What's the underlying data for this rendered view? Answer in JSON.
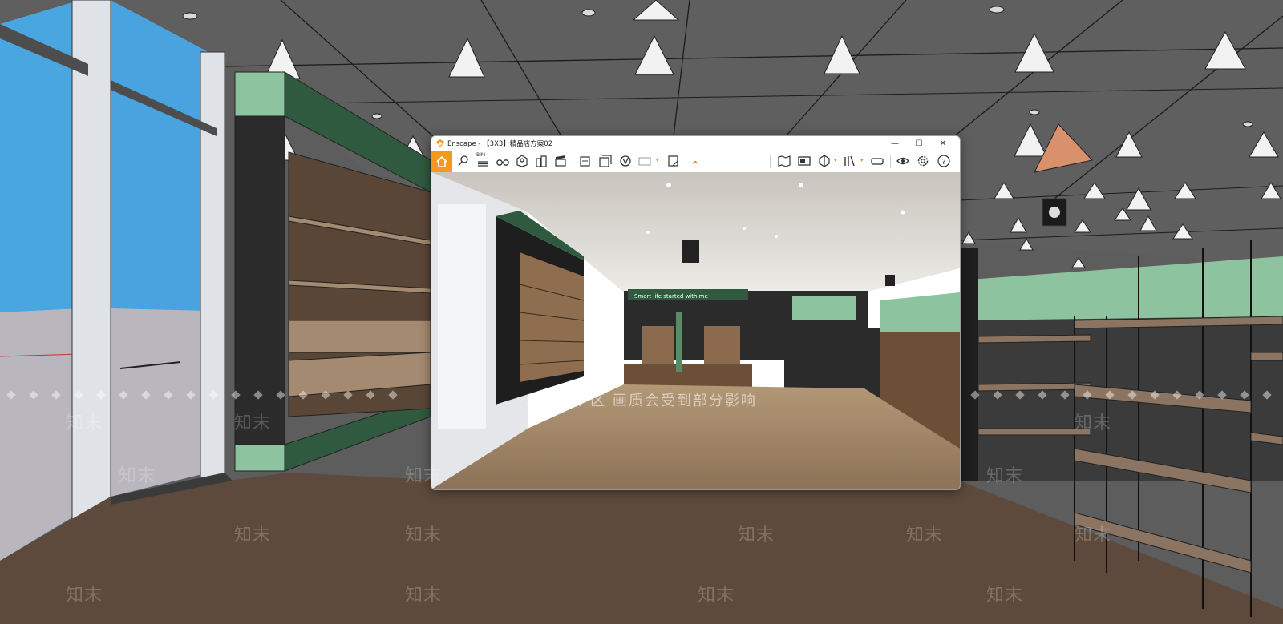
{
  "window": {
    "app": "Enscape",
    "title": "Enscape - 【3X3】精品店方案02",
    "controls": {
      "minimize": "—",
      "maximize": "☐",
      "close": "✕"
    }
  },
  "toolbar": {
    "items": [
      {
        "id": "home",
        "icon": "home-icon",
        "active": true
      },
      {
        "id": "location",
        "icon": "location-pin-icon"
      },
      {
        "id": "bim",
        "icon": "bim-icon",
        "label": "BIM"
      },
      {
        "id": "binoculars",
        "icon": "binoculars-icon"
      },
      {
        "id": "asset",
        "icon": "asset-library-icon"
      },
      {
        "id": "buildings",
        "icon": "buildings-icon"
      },
      {
        "id": "clapperboard",
        "icon": "video-clapperboard-icon"
      },
      {
        "id": "screenshot",
        "icon": "screenshot-icon"
      },
      {
        "id": "batch",
        "icon": "batch-render-icon"
      },
      {
        "id": "vr",
        "icon": "vr-export-icon"
      },
      {
        "id": "pano",
        "icon": "panorama-icon",
        "label": "360"
      },
      {
        "id": "exe",
        "icon": "exe-export-icon",
        "label": "EXE"
      },
      {
        "id": "collapse",
        "icon": "chevron-up-icon"
      },
      {
        "id": "map",
        "icon": "map-icon"
      },
      {
        "id": "views",
        "icon": "views-icon"
      },
      {
        "id": "section",
        "icon": "section-icon"
      },
      {
        "id": "library",
        "icon": "book-library-icon"
      },
      {
        "id": "vr-headset",
        "icon": "vr-headset-icon"
      },
      {
        "id": "visual",
        "icon": "eye-icon"
      },
      {
        "id": "settings",
        "icon": "gear-icon"
      },
      {
        "id": "help",
        "icon": "help-icon"
      }
    ],
    "bim_label": "BIM"
  },
  "render": {
    "store_sign": "Smart life started with me"
  },
  "watermark": {
    "banner": "水印保护区   画质会受到部分影响",
    "brand": "知末"
  },
  "colors": {
    "accent": "#f39a1e",
    "store_green": "#2f5a3f",
    "mint_panel": "#8ec3a0"
  }
}
